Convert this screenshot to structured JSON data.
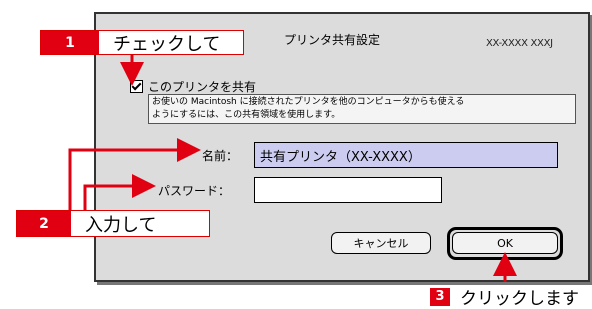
{
  "dialog": {
    "title": "プリンタ共有設定",
    "model": "XX-XXXX XXXJ",
    "share_checkbox_label": "このプリンタを共有",
    "description_lines": [
      "お使いの Macintosh に接続されたプリンタを他のコンピュータからも使える",
      "ようにするには、この共有領域を使用します。"
    ],
    "name_label": "名前：",
    "name_value": "共有プリンタ（XX-XXXX）",
    "password_label": "パスワード：",
    "password_value": "",
    "cancel_button": "キャンセル",
    "ok_button": "OK"
  },
  "callouts": [
    {
      "number": "1",
      "text": "チェックして"
    },
    {
      "number": "2",
      "text": "入力して"
    },
    {
      "number": "3",
      "text": "クリックします"
    }
  ],
  "colors": {
    "callout_red": "#e00012",
    "name_field_highlight": "#ccccf0",
    "window_bg": "#dcdcdc"
  }
}
